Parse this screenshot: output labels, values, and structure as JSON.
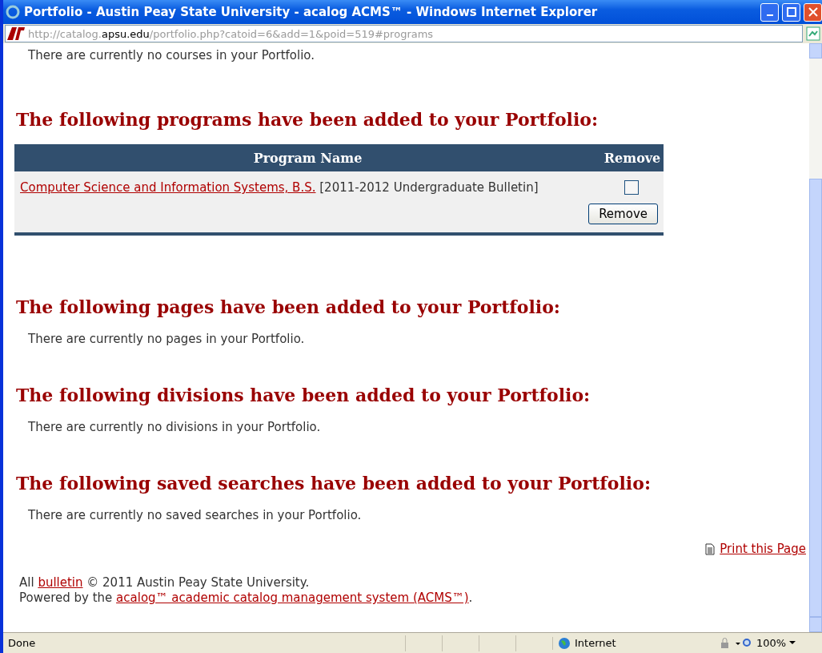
{
  "window": {
    "title": "Portfolio - Austin Peay State University - acalog ACMS™ - Windows Internet Explorer"
  },
  "address": {
    "scheme": "http://catalog.",
    "host": "apsu.edu",
    "path": "/portfolio.php?catoid=6&add=1&poid=519#programs"
  },
  "courses_empty": "There are currently no courses in your Portfolio.",
  "programs": {
    "heading": "The following programs have been added to your Portfolio:",
    "columns": [
      "Program Name",
      "Remove"
    ],
    "rows": [
      {
        "name": "Computer Science and Information Systems, B.S.",
        "catalog": "[2011-2012 Undergraduate Bulletin]",
        "checked": false
      }
    ],
    "button": "Remove"
  },
  "sections": [
    {
      "heading": "The following pages have been added to your Portfolio:",
      "empty": "There are currently no pages in your Portfolio."
    },
    {
      "heading": "The following divisions have been added to your Portfolio:",
      "empty": "There are currently no divisions in your Portfolio."
    },
    {
      "heading": "The following saved searches have been added to your Portfolio:",
      "empty": "There are currently no saved searches in your Portfolio."
    }
  ],
  "print_link": "Print this Page",
  "footer": [
    [
      {
        "text": "All "
      },
      {
        "text": "bulletin",
        "link": true
      },
      {
        "text": " © 2011 Austin Peay State University."
      }
    ],
    [
      {
        "text": "Powered by the "
      },
      {
        "text": "acalog™ academic catalog management system (ACMS™)",
        "link": true
      },
      {
        "text": "."
      }
    ]
  ],
  "status_bar": {
    "status": "Done",
    "zone": "Internet",
    "zoom": "100%"
  }
}
